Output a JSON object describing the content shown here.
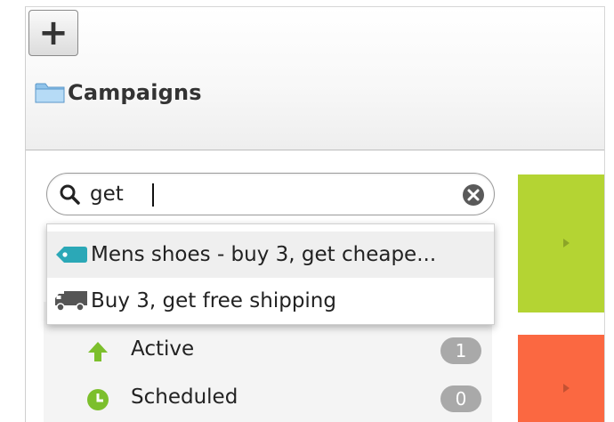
{
  "toolbar": {
    "add_label": "+"
  },
  "header": {
    "folder_title": "Campaigns"
  },
  "search": {
    "value": "get"
  },
  "suggestions": [
    {
      "label": "Mens shoes - buy 3, get cheape...",
      "icon": "tag-icon"
    },
    {
      "label": "Buy 3, get free shipping",
      "icon": "truck-icon"
    }
  ],
  "status_list": [
    {
      "label": "Active",
      "count": "1",
      "icon": "arrow-up-icon"
    },
    {
      "label": "Scheduled",
      "count": "0",
      "icon": "clock-icon"
    }
  ],
  "colors": {
    "accent_green": "#b4d433",
    "accent_orange": "#fb6841",
    "tag_teal": "#2ba8b7",
    "badge_gray": "#a9a9a9"
  }
}
